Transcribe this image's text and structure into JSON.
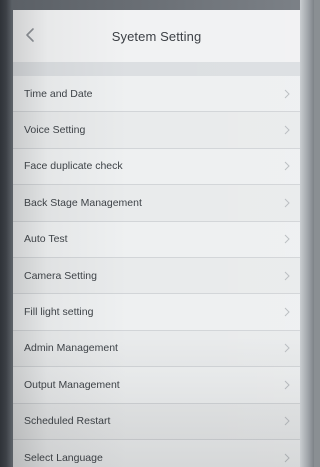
{
  "header": {
    "title": "Syetem Setting",
    "back_icon": "chevron-left-icon"
  },
  "menu": {
    "items": [
      {
        "label": "Time and Date"
      },
      {
        "label": "Voice Setting"
      },
      {
        "label": "Face duplicate check"
      },
      {
        "label": "Back Stage Management"
      },
      {
        "label": "Auto Test"
      },
      {
        "label": "Camera Setting"
      },
      {
        "label": "Fill light setting"
      },
      {
        "label": "Admin Management"
      },
      {
        "label": "Output Management"
      },
      {
        "label": "Scheduled Restart"
      },
      {
        "label": "Select Language"
      }
    ],
    "item_icon": "chevron-right-icon"
  },
  "colors": {
    "background": "#e6e8ea",
    "text": "#3e4348",
    "chevron": "#b9bdc1"
  }
}
